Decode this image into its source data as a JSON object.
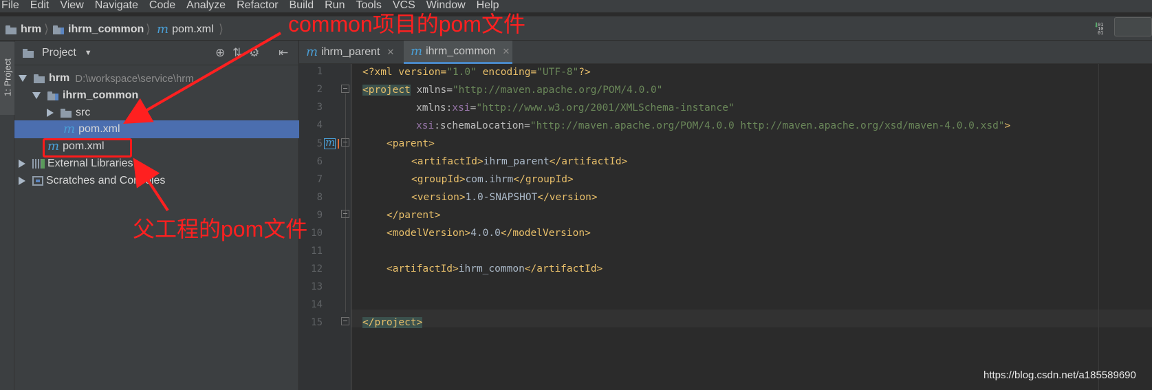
{
  "menu": [
    "File",
    "Edit",
    "View",
    "Navigate",
    "Code",
    "Analyze",
    "Refactor",
    "Build",
    "Run",
    "Tools",
    "VCS",
    "Window",
    "Help"
  ],
  "breadcrumb": {
    "project": "hrm",
    "module": "ihrm_common",
    "file": "pom.xml"
  },
  "left_stripe": {
    "label": "1: Project"
  },
  "project_panel": {
    "title": "Project",
    "tree": {
      "root_name": "hrm",
      "root_path": "D:\\workspace\\service\\hrm",
      "module_name": "ihrm_common",
      "src": "src",
      "module_pom": "pom.xml",
      "root_pom": "pom.xml",
      "external_libraries": "External Libraries",
      "scratches": "Scratches and Consoles"
    }
  },
  "tabs": [
    {
      "label": "ihrm_parent",
      "active": false
    },
    {
      "label": "ihrm_common",
      "active": true
    }
  ],
  "editor": {
    "line_numbers": [
      "1",
      "2",
      "3",
      "4",
      "5",
      "6",
      "7",
      "8",
      "9",
      "10",
      "11",
      "12",
      "13",
      "14",
      "15"
    ],
    "lines": {
      "l1": {
        "t1": "<?xml version=",
        "v1": "\"1.0\"",
        "t2": " encoding=",
        "v2": "\"UTF-8\"",
        "t3": "?>"
      },
      "l2": {
        "tag": "<project",
        "attr": " xmlns=",
        "val": "\"http://maven.apache.org/POM/4.0.0\""
      },
      "l3": {
        "attr": "xmlns:",
        "ns": "xsi",
        "eq": "=",
        "val": "\"http://www.w3.org/2001/XMLSchema-instance\""
      },
      "l4": {
        "ns": "xsi",
        "attr": ":schemaLocation=",
        "val": "\"http://maven.apache.org/POM/4.0.0 http://maven.apache.org/xsd/maven-4.0.0.xsd\"",
        "end": ">"
      },
      "l5": {
        "tag": "<parent>"
      },
      "l6": {
        "open": "<artifactId>",
        "text": "ihrm_parent",
        "close": "</artifactId>"
      },
      "l7": {
        "open": "<groupId>",
        "text": "com.ihrm",
        "close": "</groupId>"
      },
      "l8": {
        "open": "<version>",
        "text": "1.0-SNAPSHOT",
        "close": "</version>"
      },
      "l9": {
        "tag": "</parent>"
      },
      "l10": {
        "open": "<modelVersion>",
        "text": "4.0.0",
        "close": "</modelVersion>"
      },
      "l12": {
        "open": "<artifactId>",
        "text": "ihrm_common",
        "close": "</artifactId>"
      },
      "l15": {
        "tag": "</project>"
      }
    }
  },
  "annotations": {
    "top": "common项目的pom文件",
    "bottom": "父工程的pom文件",
    "color": "#ff2020"
  },
  "watermark": "https://blog.csdn.net/a185589690",
  "colors": {
    "tag": "#e8bf6a",
    "attr_value": "#6a8759",
    "namespace": "#9876aa",
    "selection": "#4b6eaf"
  }
}
